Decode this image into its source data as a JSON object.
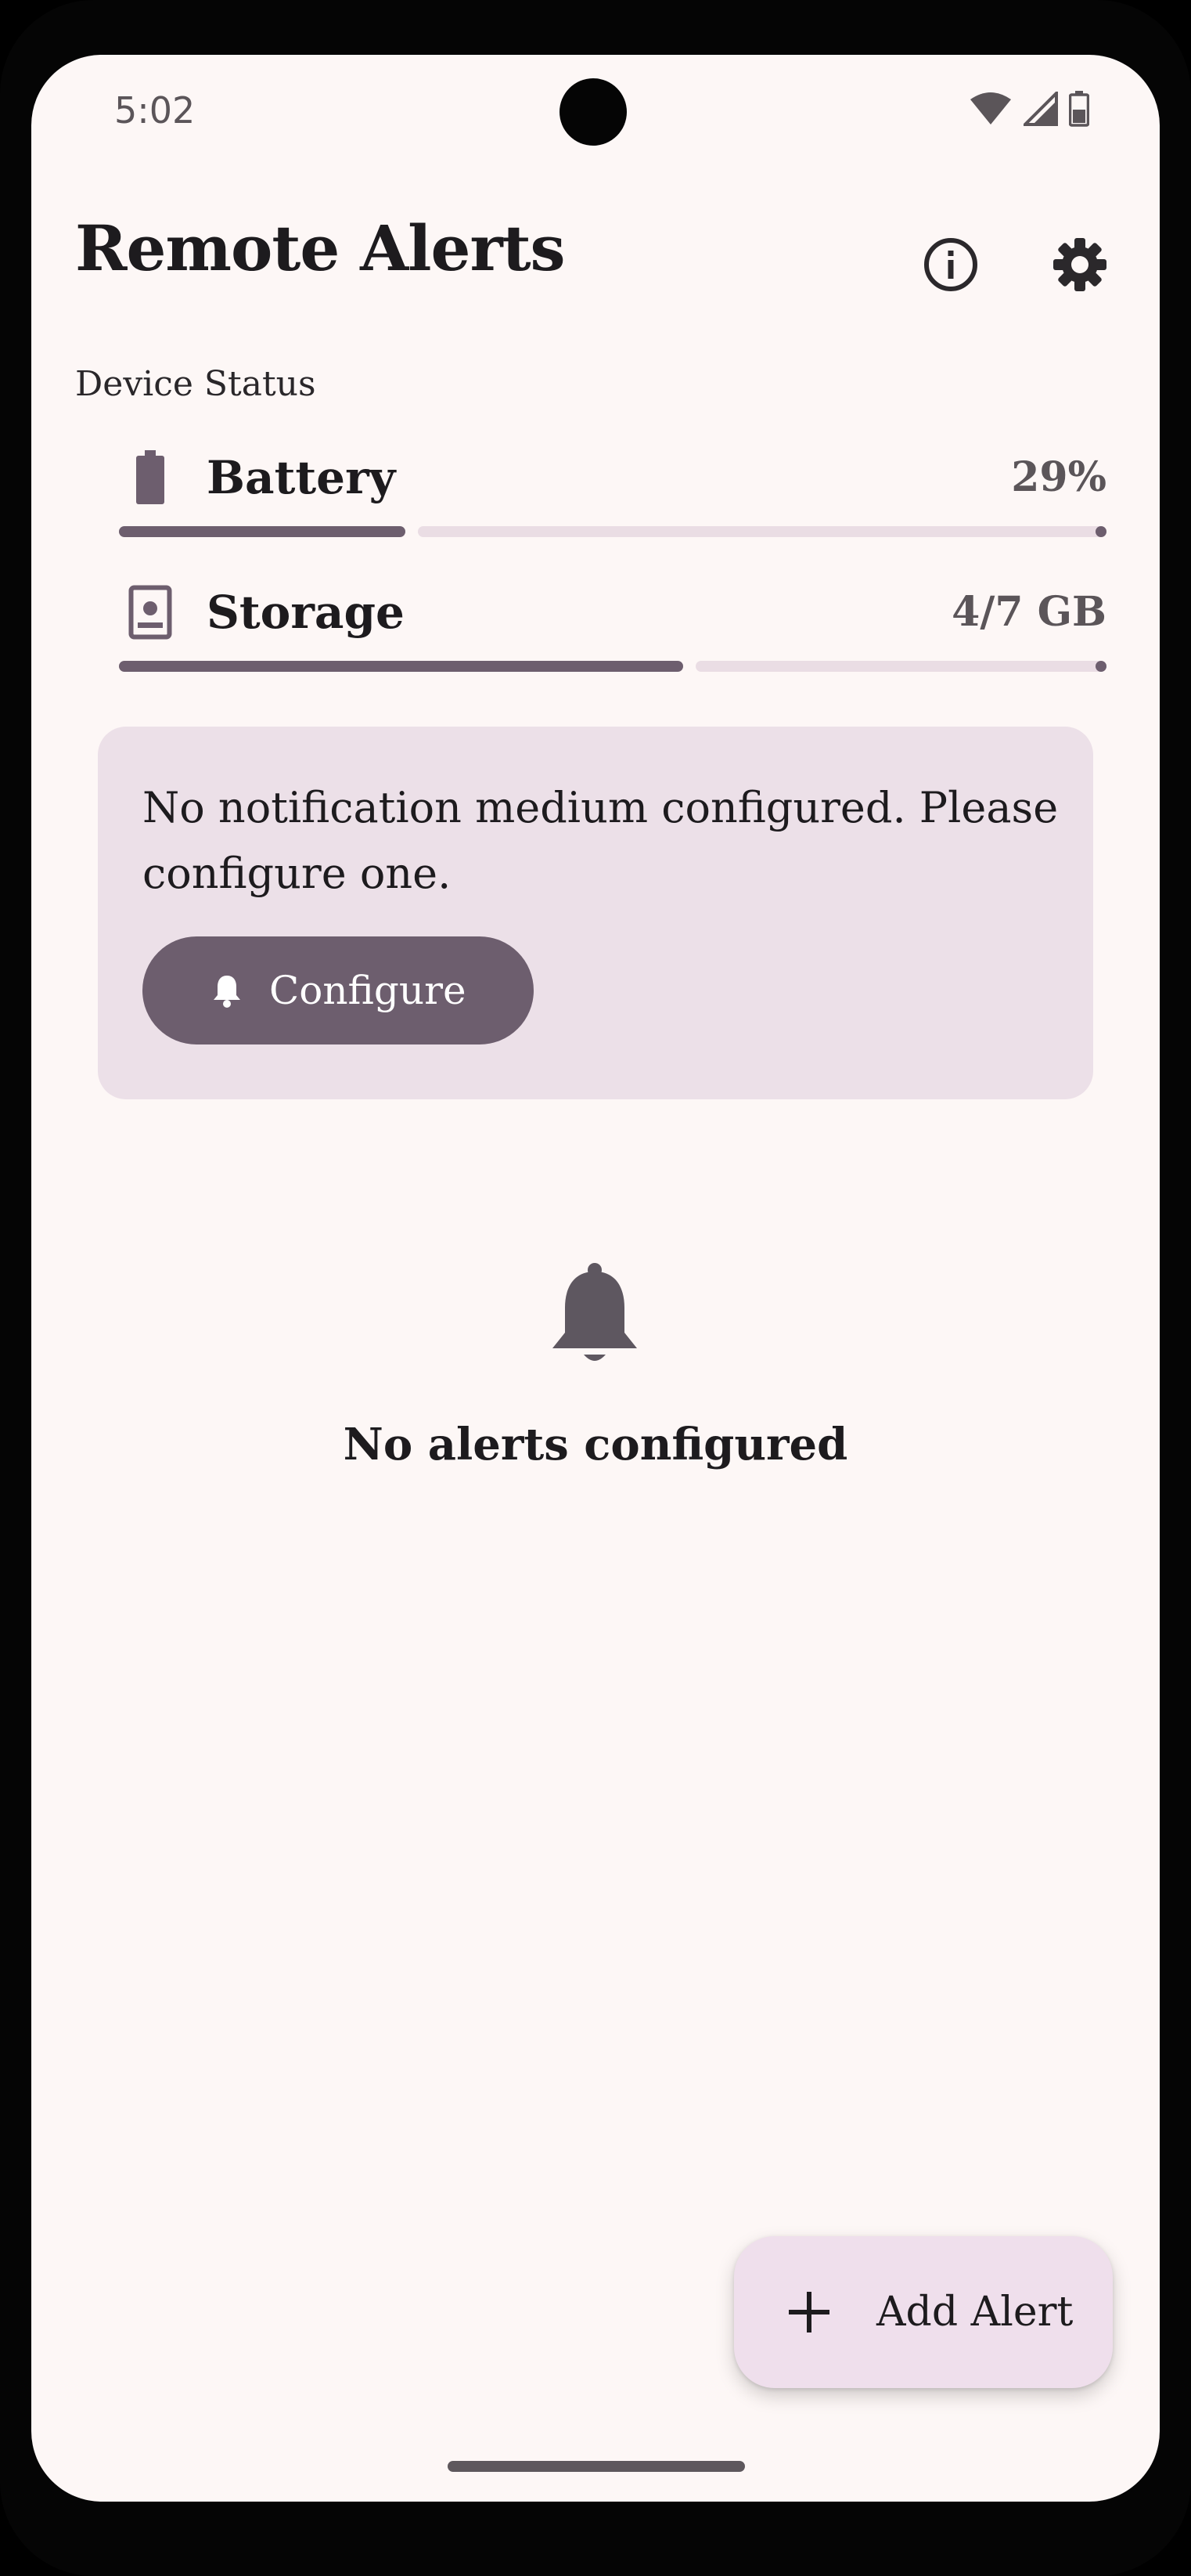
{
  "status_bar": {
    "time": "5:02",
    "icons": [
      "wifi-icon",
      "cellular-signal-icon",
      "battery-icon"
    ]
  },
  "app_bar": {
    "title": "Remote Alerts",
    "actions": [
      "info-icon",
      "settings-gear-icon"
    ]
  },
  "device_status": {
    "label": "Device Status",
    "battery": {
      "label": "Battery",
      "value": "29%",
      "level": 0.29,
      "icon": "battery-icon"
    },
    "storage": {
      "label": "Storage",
      "value": "4/7 GB",
      "level": 0.5714,
      "icon": "storage-icon"
    }
  },
  "notice": {
    "message": "No notification medium configured. Please configure one.",
    "button_label": "Configure",
    "button_icon": "bell-icon"
  },
  "empty_state": {
    "icon": "bell-icon",
    "text": "No alerts configured"
  },
  "fab": {
    "label": "Add Alert",
    "icon": "plus-icon"
  },
  "colors": {
    "background": "#fdf7f6",
    "primary": "#6d5e6e",
    "track": "#eadde4",
    "card": "#ece0e8",
    "fab": "#efdfec",
    "text": "#1d1b1e"
  }
}
